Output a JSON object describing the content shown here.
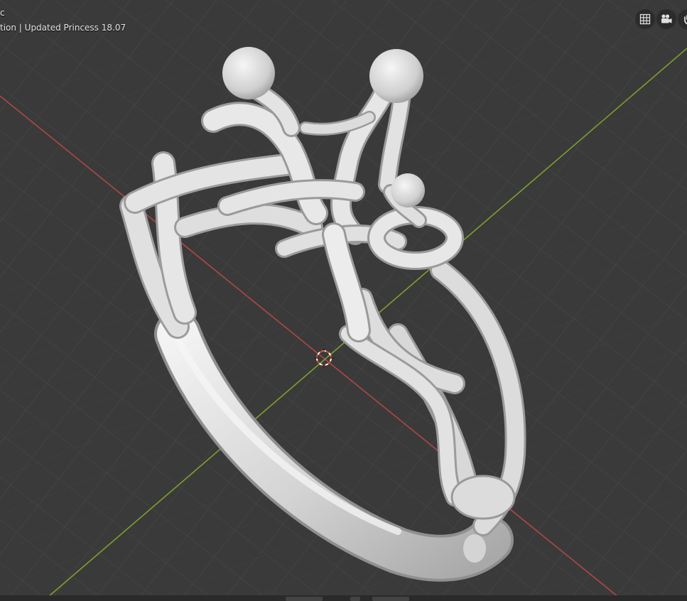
{
  "overlay": {
    "view_name": "c",
    "collection_label": "tion | Updated Princess 18.07"
  },
  "gizmos": {
    "grid_toggle": "grid-icon",
    "camera_view": "camera-icon",
    "pan_view": "hand-icon"
  },
  "colors": {
    "viewport_bg": "#3a3a3a",
    "grid_line": "#4a4a4a",
    "x_axis": "#b64a4a",
    "y_axis": "#7aa32c",
    "mesh": "#e0e0e0",
    "cursor": "#e27b3a"
  }
}
